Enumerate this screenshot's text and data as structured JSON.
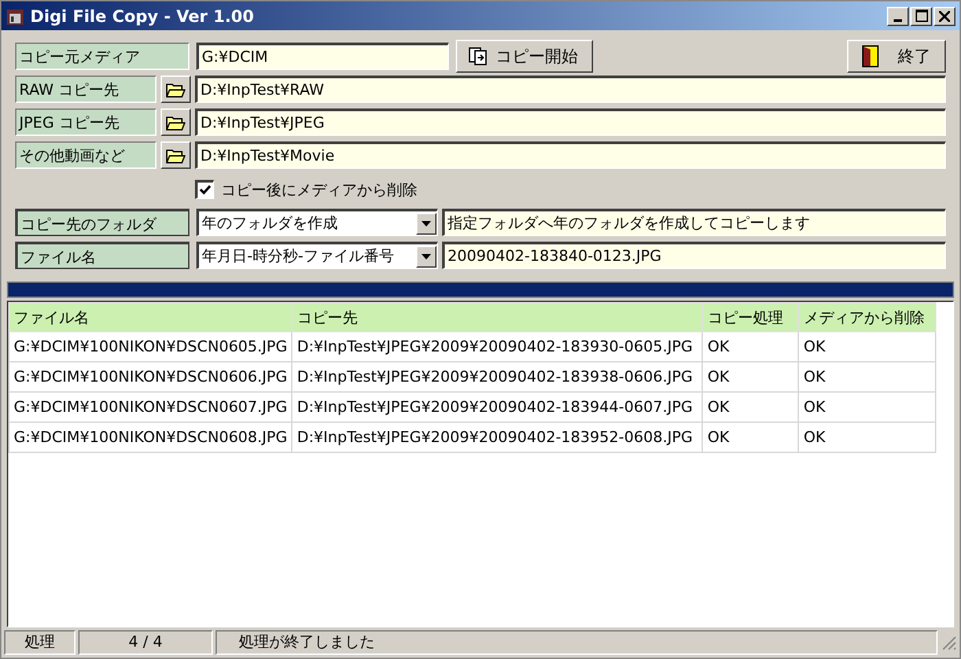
{
  "window": {
    "title": "Digi File Copy  - Ver 1.00"
  },
  "source": {
    "label": "コピー元メディア",
    "value": "G:¥DCIM"
  },
  "copy_button": "コピー開始",
  "exit_button": "終了",
  "destinations": [
    {
      "label": "RAW コピー先",
      "value": "D:¥InpTest¥RAW"
    },
    {
      "label": "JPEG コピー先",
      "value": "D:¥InpTest¥JPEG"
    },
    {
      "label": "その他動画など",
      "value": "D:¥InpTest¥Movie"
    }
  ],
  "delete_option": {
    "label": "コピー後にメディアから削除",
    "checked": true
  },
  "options": [
    {
      "label": "コピー先のフォルダ",
      "choice": "年のフォルダを作成",
      "description": "指定フォルダへ年のフォルダを作成してコピーします"
    },
    {
      "label": "ファイル名",
      "choice": "年月日-時分秒-ファイル番号",
      "description": "20090402-183840-0123.JPG"
    }
  ],
  "progress": {
    "level": 1
  },
  "table": {
    "columns": [
      "ファイル名",
      "コピー先",
      "コピー処理",
      "メディアから削除"
    ],
    "rows": [
      [
        "G:¥DCIM¥100NIKON¥DSCN0605.JPG",
        "D:¥InpTest¥JPEG¥2009¥20090402-183930-0605.JPG",
        "OK",
        "OK"
      ],
      [
        "G:¥DCIM¥100NIKON¥DSCN0606.JPG",
        "D:¥InpTest¥JPEG¥2009¥20090402-183938-0606.JPG",
        "OK",
        "OK"
      ],
      [
        "G:¥DCIM¥100NIKON¥DSCN0607.JPG",
        "D:¥InpTest¥JPEG¥2009¥20090402-183944-0607.JPG",
        "OK",
        "OK"
      ],
      [
        "G:¥DCIM¥100NIKON¥DSCN0608.JPG",
        "D:¥InpTest¥JPEG¥2009¥20090402-183952-0608.JPG",
        "OK",
        "OK"
      ]
    ]
  },
  "status_bar": [
    "処理",
    "4 / 4",
    "処理が終了しました"
  ]
}
